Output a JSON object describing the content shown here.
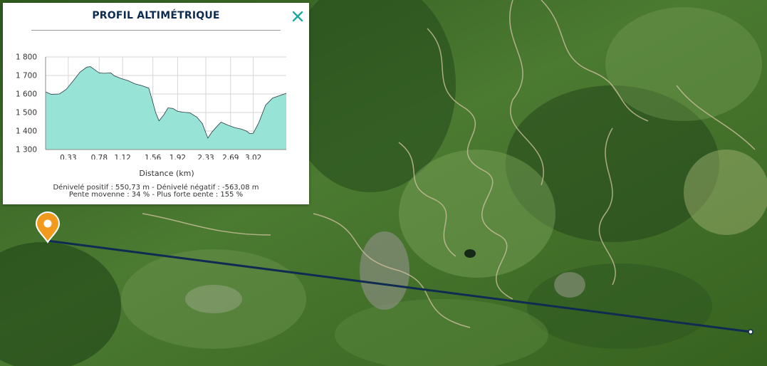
{
  "panel": {
    "title": "PROFIL ALTIMÉTRIQUE",
    "close_icon": "close-icon",
    "stats_line1": "Dénivelé positif : 550,73 m - Dénivelé négatif : -563,08 m",
    "stats_line2": "Pente moyenne : 34 % - Plus forte pente : 155 %"
  },
  "colors": {
    "accent": "#1aa89a",
    "profile_fill": "#97e3d6",
    "profile_stroke": "#2b3b45",
    "title": "#0d2a4f",
    "route_line": "#0f2b52",
    "marker": "#f29a1d"
  },
  "chart_data": {
    "type": "area",
    "title": "",
    "xlabel": "Distance (km)",
    "ylabel": "",
    "xlim": [
      0,
      3.5
    ],
    "ylim": [
      1300,
      1800
    ],
    "grid": true,
    "yticks": [
      1300,
      1400,
      1500,
      1600,
      1700,
      1800
    ],
    "ytick_labels": [
      "1 300",
      "1 400",
      "1 500",
      "1 600",
      "1 700",
      "1 800"
    ],
    "xticks": [
      0.33,
      0.78,
      1.12,
      1.56,
      1.92,
      2.33,
      2.69,
      3.02
    ],
    "xtick_labels": [
      "0,33",
      "0,78",
      "1,12",
      "1,56",
      "1,92",
      "2,33",
      "2,69",
      "3,02"
    ],
    "x": [
      0,
      0.08,
      0.2,
      0.3,
      0.4,
      0.5,
      0.6,
      0.65,
      0.7,
      0.78,
      0.85,
      0.95,
      1.0,
      1.1,
      1.2,
      1.3,
      1.4,
      1.5,
      1.55,
      1.6,
      1.65,
      1.72,
      1.78,
      1.85,
      1.92,
      2.0,
      2.1,
      2.2,
      2.28,
      2.33,
      2.36,
      2.42,
      2.48,
      2.55,
      2.65,
      2.75,
      2.85,
      2.92,
      2.97,
      3.02,
      3.1,
      3.2,
      3.3,
      3.5
    ],
    "y": [
      1612,
      1598,
      1600,
      1625,
      1670,
      1718,
      1745,
      1748,
      1735,
      1714,
      1712,
      1714,
      1698,
      1684,
      1672,
      1655,
      1645,
      1632,
      1568,
      1500,
      1455,
      1488,
      1525,
      1522,
      1506,
      1502,
      1498,
      1475,
      1440,
      1390,
      1362,
      1395,
      1420,
      1448,
      1432,
      1418,
      1410,
      1400,
      1386,
      1388,
      1445,
      1540,
      1578,
      1604
    ]
  },
  "map": {
    "marker_icon": "location-pin-icon",
    "route": "route-line"
  }
}
